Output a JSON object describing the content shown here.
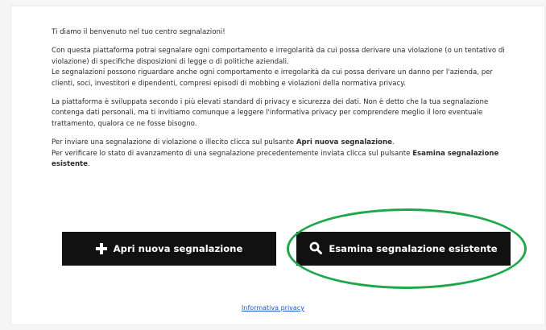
{
  "intro": {
    "p1": "Ti diamo il benvenuto nel tuo centro segnalazioni!",
    "p2a": "Con questa piattaforma potrai segnalare ogni comportamento e irregolarità da cui possa derivare una violazione (o un tentativo di violazione) di specifiche disposizioni di legge o di politiche aziendali.",
    "p2b": "Le segnalazioni possono riguardare anche ogni comportamento e irregolarità da cui possa derivare un danno per l'azienda, per clienti, soci, investitori e dipendenti, compresi episodi di mobbing e violazioni della normativa privacy.",
    "p3": "La piattaforma è sviluppata secondo i più elevati standard di privacy e sicurezza dei dati. Non è detto che la tua segnalazione contenga dati personali, ma ti invitiamo comunque a leggere l'informativa privacy per comprendere meglio il loro eventuale trattamento, qualora ce ne fosse bisogno.",
    "p4_prefix": "Per inviare una segnalazione di violazione o illecito clicca sul pulsante ",
    "p4_bold": "Apri nuova segnalazione",
    "p4_suffix": ".",
    "p5_prefix": "Per verificare lo stato di avanzamento di una segnalazione precedentemente inviata clicca sul pulsante ",
    "p5_bold": "Esamina segnalazione esistente",
    "p5_suffix": "."
  },
  "buttons": {
    "new_label": "Apri nuova segnalazione",
    "new_icon": "plus-icon",
    "exam_label": "Esamina segnalazione esistente",
    "exam_icon": "search-icon"
  },
  "footer": {
    "privacy_link": "Informativa privacy"
  },
  "colors": {
    "button_bg": "#111111",
    "highlight": "#1fa84a",
    "link": "#1b57c9"
  }
}
